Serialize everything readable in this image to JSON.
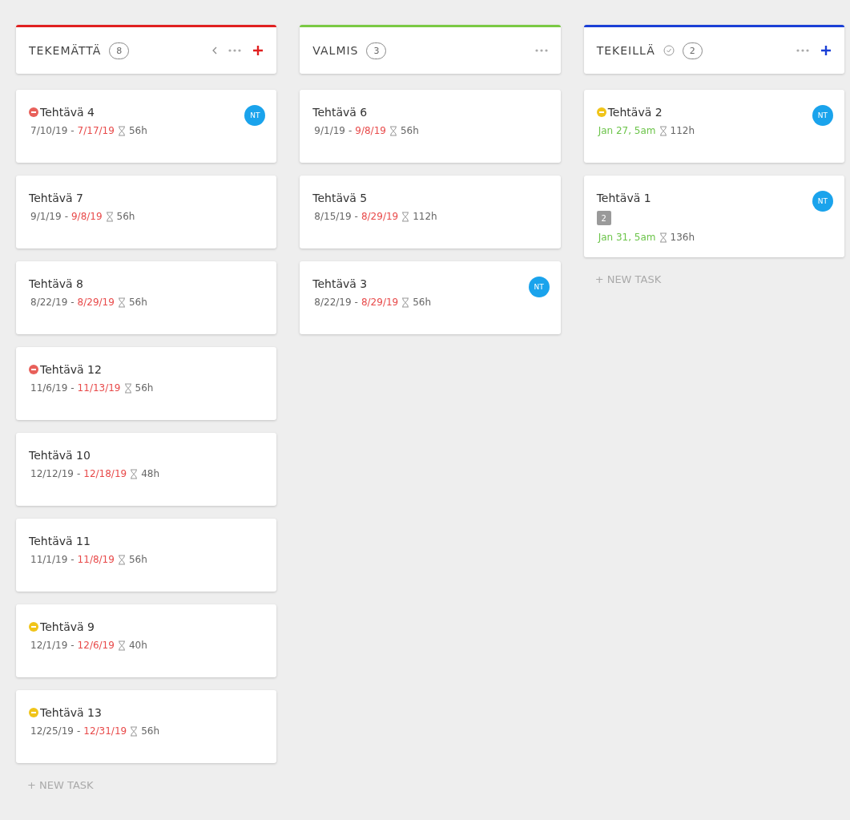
{
  "columns": [
    {
      "title": "TEKEMÄTTÄ",
      "count": "8",
      "color": "#e02020",
      "collapse": true,
      "done_icon": false,
      "add": true,
      "new_task": "+ NEW TASK",
      "cards": [
        {
          "title": "Tehtävä 4",
          "color": "#e8605a",
          "start": "7/10/19",
          "separator": "-",
          "due": "7/17/19",
          "overdue": true,
          "estimate": "56h",
          "assignee": "NT"
        },
        {
          "title": "Tehtävä 7",
          "start": "9/1/19",
          "separator": "-",
          "due": "9/8/19",
          "overdue": true,
          "estimate": "56h"
        },
        {
          "title": "Tehtävä 8",
          "start": "8/22/19",
          "separator": "-",
          "due": "8/29/19",
          "overdue": true,
          "estimate": "56h"
        },
        {
          "title": "Tehtävä 12",
          "color": "#e8605a",
          "start": "11/6/19",
          "separator": "-",
          "due": "11/13/19",
          "overdue": true,
          "estimate": "56h"
        },
        {
          "title": "Tehtävä 10",
          "start": "12/12/19",
          "separator": "-",
          "due": "12/18/19",
          "overdue": true,
          "estimate": "48h"
        },
        {
          "title": "Tehtävä 11",
          "start": "11/1/19",
          "separator": "-",
          "due": "11/8/19",
          "overdue": true,
          "estimate": "56h"
        },
        {
          "title": "Tehtävä 9",
          "color": "#f0c419",
          "start": "12/1/19",
          "separator": "-",
          "due": "12/6/19",
          "overdue": true,
          "estimate": "40h"
        },
        {
          "title": "Tehtävä 13",
          "color": "#f0c419",
          "start": "12/25/19",
          "separator": "-",
          "due": "12/31/19",
          "overdue": true,
          "estimate": "56h"
        }
      ]
    },
    {
      "title": "VALMIS",
      "count": "3",
      "color": "#7ac943",
      "collapse": false,
      "done_icon": false,
      "add": false,
      "cards": [
        {
          "title": "Tehtävä 6",
          "start": "9/1/19",
          "separator": "-",
          "due": "9/8/19",
          "overdue": true,
          "estimate": "56h"
        },
        {
          "title": "Tehtävä 5",
          "start": "8/15/19",
          "separator": "-",
          "due": "8/29/19",
          "overdue": true,
          "estimate": "112h"
        },
        {
          "title": "Tehtävä 3",
          "start": "8/22/19",
          "separator": "-",
          "due": "8/29/19",
          "overdue": true,
          "estimate": "56h",
          "assignee": "NT"
        }
      ]
    },
    {
      "title": "TEKEILLÄ",
      "count": "2",
      "color": "#1a3fd6",
      "collapse": false,
      "done_icon": true,
      "add": true,
      "new_task": "+ NEW TASK",
      "cards": [
        {
          "title": "Tehtävä 2",
          "color": "#f0c419",
          "due": "Jan 27, 5am",
          "overdue": false,
          "estimate": "112h",
          "assignee": "NT"
        },
        {
          "title": "Tehtävä 1",
          "subtasks": "2",
          "due": "Jan 31, 5am",
          "overdue": false,
          "estimate": "136h",
          "assignee": "NT"
        }
      ]
    }
  ]
}
